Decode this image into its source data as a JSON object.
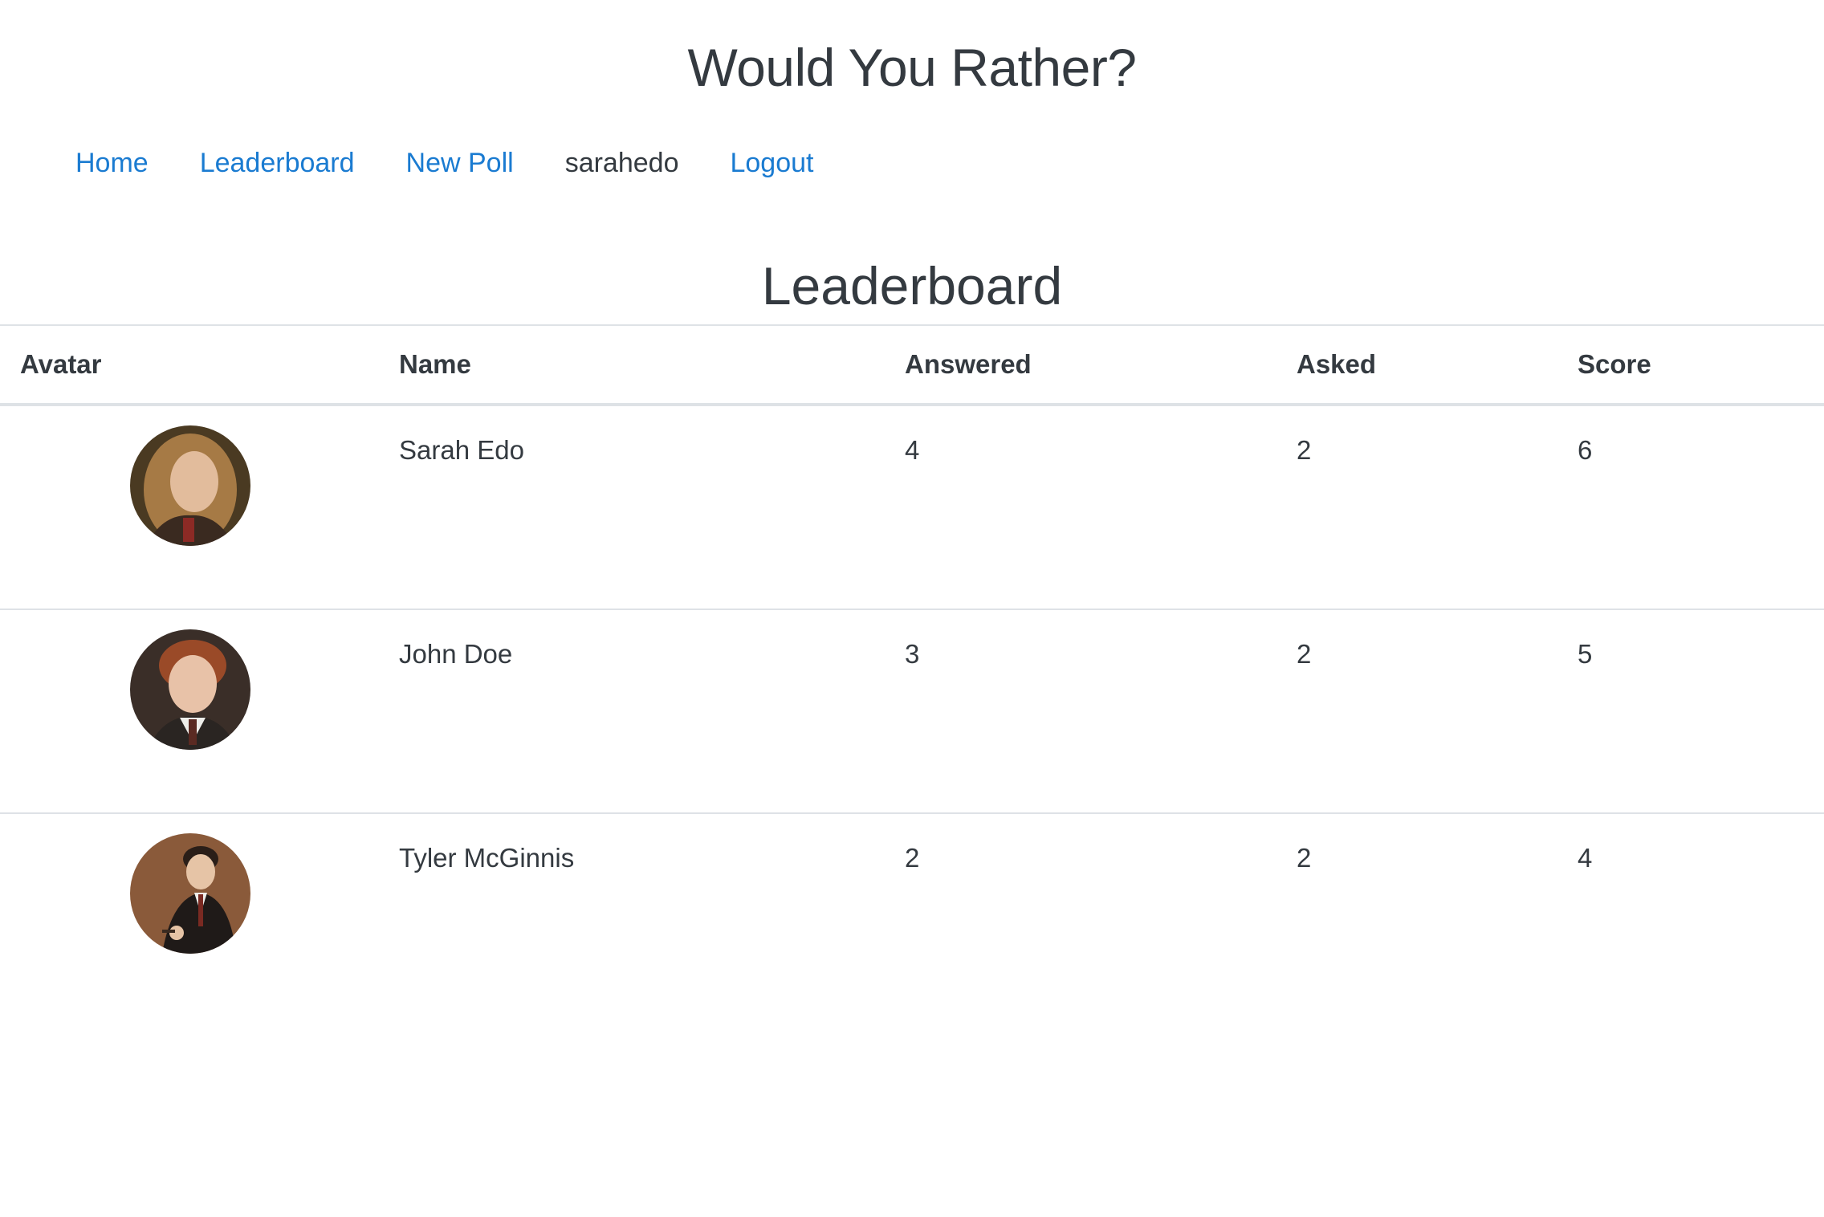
{
  "app": {
    "title": "Would You Rather?"
  },
  "nav": {
    "home": "Home",
    "leaderboard": "Leaderboard",
    "new_poll": "New Poll",
    "current_user": "sarahedo",
    "logout": "Logout"
  },
  "page": {
    "heading": "Leaderboard"
  },
  "table": {
    "headers": {
      "avatar": "Avatar",
      "name": "Name",
      "answered": "Answered",
      "asked": "Asked",
      "score": "Score"
    },
    "rows": [
      {
        "name": "Sarah Edo",
        "answered": "4",
        "asked": "2",
        "score": "6",
        "avatar_icon": "user-avatar-photo"
      },
      {
        "name": "John Doe",
        "answered": "3",
        "asked": "2",
        "score": "5",
        "avatar_icon": "user-avatar-photo"
      },
      {
        "name": "Tyler McGinnis",
        "answered": "2",
        "asked": "2",
        "score": "4",
        "avatar_icon": "user-avatar-photo"
      }
    ]
  },
  "colors": {
    "link": "#1a7bd1",
    "text": "#343a40",
    "border": "#dee2e6"
  }
}
